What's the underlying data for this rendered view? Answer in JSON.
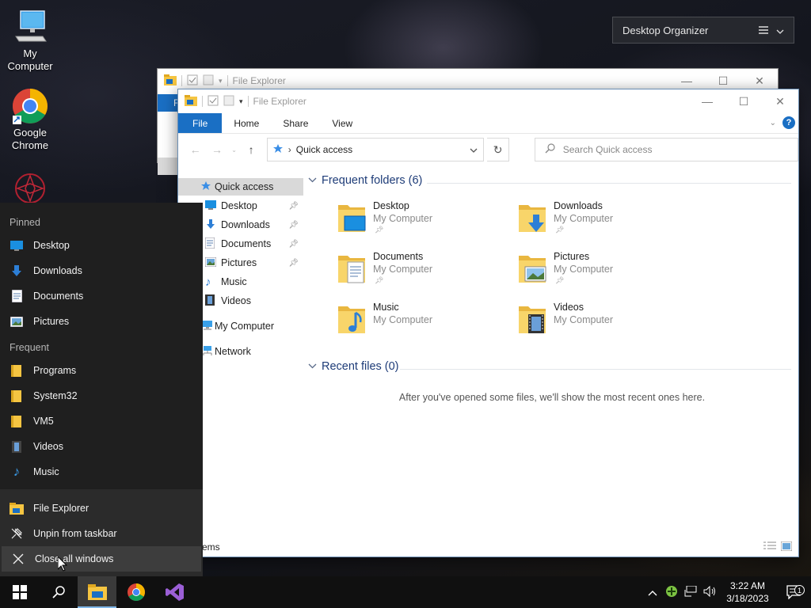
{
  "desktop": {
    "icons": [
      {
        "label": "My Computer"
      },
      {
        "label": "Google Chrome"
      }
    ]
  },
  "organizer": {
    "title": "Desktop Organizer"
  },
  "explorer_back": {
    "title": "File Explorer",
    "file_tab": "F"
  },
  "explorer": {
    "title": "File Explorer",
    "ribbon_tabs": [
      "File",
      "Home",
      "Share",
      "View"
    ],
    "address": "Quick access",
    "search_placeholder": "Search Quick access",
    "nav": [
      {
        "label": "Quick access",
        "icon": "star-icon",
        "selected": true
      },
      {
        "label": "Desktop",
        "icon": "desktop-icon",
        "pinned": true
      },
      {
        "label": "Downloads",
        "icon": "downloads-icon",
        "pinned": true
      },
      {
        "label": "Documents",
        "icon": "documents-icon",
        "pinned": true
      },
      {
        "label": "Pictures",
        "icon": "pictures-icon",
        "pinned": true
      },
      {
        "label": "Music",
        "icon": "music-icon"
      },
      {
        "label": "Videos",
        "icon": "videos-icon"
      },
      {
        "label": "My Computer",
        "icon": "computer-icon"
      },
      {
        "label": "Network",
        "icon": "network-icon"
      }
    ],
    "frequent_header": "Frequent folders (6)",
    "folders": [
      {
        "name": "Desktop",
        "location": "My Computer",
        "pinned": true,
        "overlay": "desktop"
      },
      {
        "name": "Downloads",
        "location": "My Computer",
        "pinned": true,
        "overlay": "downloads"
      },
      {
        "name": "Documents",
        "location": "My Computer",
        "pinned": true,
        "overlay": "documents"
      },
      {
        "name": "Pictures",
        "location": "My Computer",
        "pinned": true,
        "overlay": "pictures"
      },
      {
        "name": "Music",
        "location": "My Computer",
        "pinned": false,
        "overlay": "music"
      },
      {
        "name": "Videos",
        "location": "My Computer",
        "pinned": false,
        "overlay": "videos"
      }
    ],
    "recent_header": "Recent files (0)",
    "recent_empty": "After you've opened some files, we'll show the most recent ones here.",
    "status": "ems"
  },
  "jumplist": {
    "pinned_header": "Pinned",
    "pinned": [
      {
        "label": "Desktop",
        "icon": "desktop-icon"
      },
      {
        "label": "Downloads",
        "icon": "downloads-icon"
      },
      {
        "label": "Documents",
        "icon": "documents-icon"
      },
      {
        "label": "Pictures",
        "icon": "pictures-icon"
      }
    ],
    "frequent_header": "Frequent",
    "frequent": [
      {
        "label": "Programs",
        "icon": "folder-icon"
      },
      {
        "label": "System32",
        "icon": "folder-icon"
      },
      {
        "label": "VM5",
        "icon": "folder-icon"
      },
      {
        "label": "Videos",
        "icon": "videos-icon"
      },
      {
        "label": "Music",
        "icon": "music-icon"
      }
    ],
    "actions": [
      {
        "label": "File Explorer",
        "icon": "file-explorer-icon"
      },
      {
        "label": "Unpin from taskbar",
        "icon": "unpin-icon"
      },
      {
        "label": "Close all windows",
        "icon": "close-icon"
      }
    ]
  },
  "taskbar": {
    "clock_time": "3:22 AM",
    "clock_date": "3/18/2023",
    "notification_count": "1"
  }
}
